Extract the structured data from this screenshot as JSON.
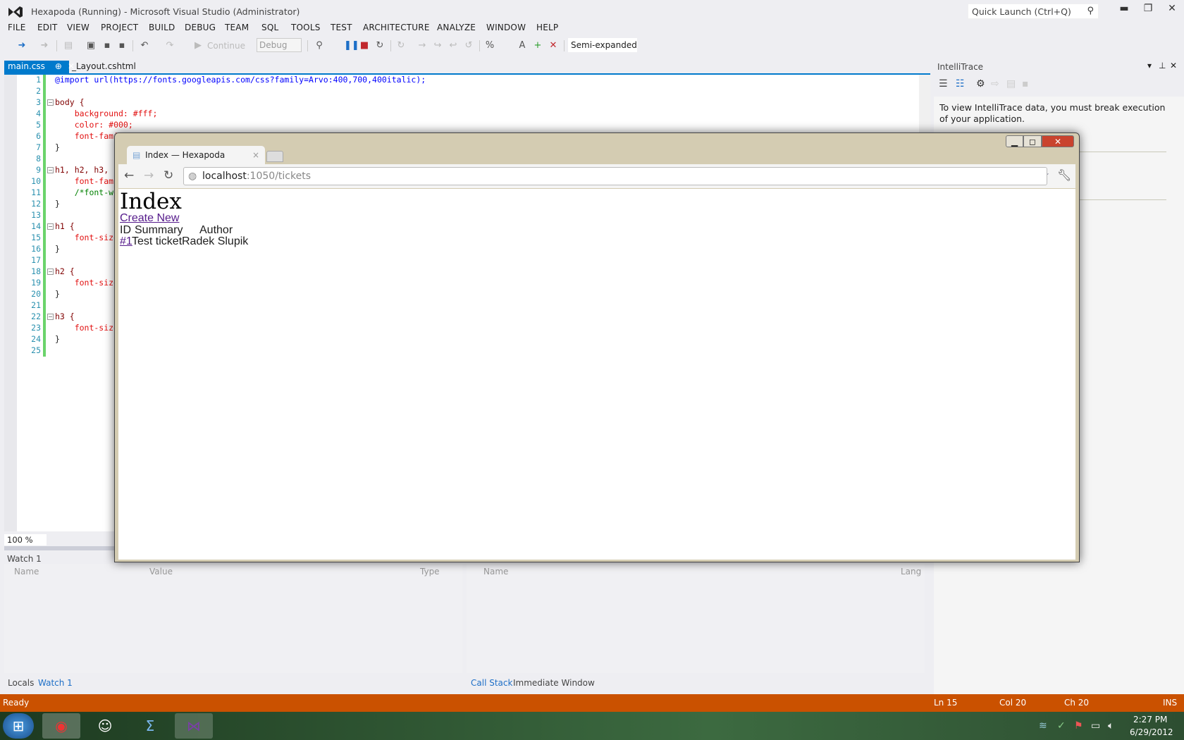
{
  "window": {
    "title": "Hexapoda (Running) - Microsoft Visual Studio (Administrator)",
    "quick_launch_placeholder": "Quick Launch (Ctrl+Q)"
  },
  "menu": [
    "FILE",
    "EDIT",
    "VIEW",
    "PROJECT",
    "BUILD",
    "DEBUG",
    "TEAM",
    "SQL",
    "TOOLS",
    "TEST",
    "ARCHITECTURE",
    "ANALYZE",
    "WINDOW",
    "HELP"
  ],
  "toolbar": {
    "continue_label": "Continue",
    "config_value": "Debug",
    "view_mode_value": "Semi-expanded"
  },
  "doc_tabs": [
    {
      "label": "main.css",
      "active": true
    },
    {
      "label": "_Layout.cshtml",
      "active": false
    }
  ],
  "editor": {
    "zoom_value": "100 %",
    "line_numbers": [
      "1",
      "2",
      "3",
      "4",
      "5",
      "6",
      "7",
      "8",
      "9",
      "10",
      "11",
      "12",
      "13",
      "14",
      "15",
      "16",
      "17",
      "18",
      "19",
      "20",
      "21",
      "22",
      "23",
      "24",
      "25"
    ],
    "lines": [
      "@import url(https://fonts.googleapis.com/css?family=Arvo:400,700,400italic);",
      "",
      "body {",
      "    background: #fff;",
      "    color: #000;",
      "    font-famil",
      "}",
      "",
      "h1, h2, h3,",
      "    font-famil",
      "    /*font-wei",
      "}",
      "",
      "h1 {",
      "    font-size:",
      "}",
      "",
      "h2 {",
      "    font-size:",
      "}",
      "",
      "h3 {",
      "    font-size:",
      "}",
      ""
    ]
  },
  "intellitrace": {
    "title": "IntelliTrace",
    "message": "To view IntelliTrace data, you must break execution of your application."
  },
  "watch": {
    "title": "Watch 1",
    "columns": [
      "Name",
      "Value",
      "Type"
    ]
  },
  "callstack": {
    "columns": [
      "Name",
      "Lang"
    ]
  },
  "bottom_tabs_left": [
    "Locals",
    "Watch 1"
  ],
  "bottom_tabs_right": [
    "Call Stack",
    "Immediate Window"
  ],
  "status": {
    "text": "Ready",
    "ln": "Ln 15",
    "col": "Col 20",
    "ch": "Ch 20",
    "mode": "INS"
  },
  "browser": {
    "tab_title": "Index — Hexapoda",
    "url_host": "localhost",
    "url_path": ":1050/tickets",
    "page": {
      "heading": "Index",
      "create_link": "Create New",
      "table_headers": [
        "ID",
        "Summary",
        "Author"
      ],
      "rows": [
        {
          "id": "#1",
          "summary": "Test ticket",
          "author": "Radek Slupik"
        }
      ]
    }
  },
  "taskbar": {
    "time": "2:27 PM",
    "date": "6/29/2012"
  },
  "colors": {
    "accent": "#007acc",
    "status_bar": "#ca5100",
    "code_line_marker": "#6bd36b"
  }
}
